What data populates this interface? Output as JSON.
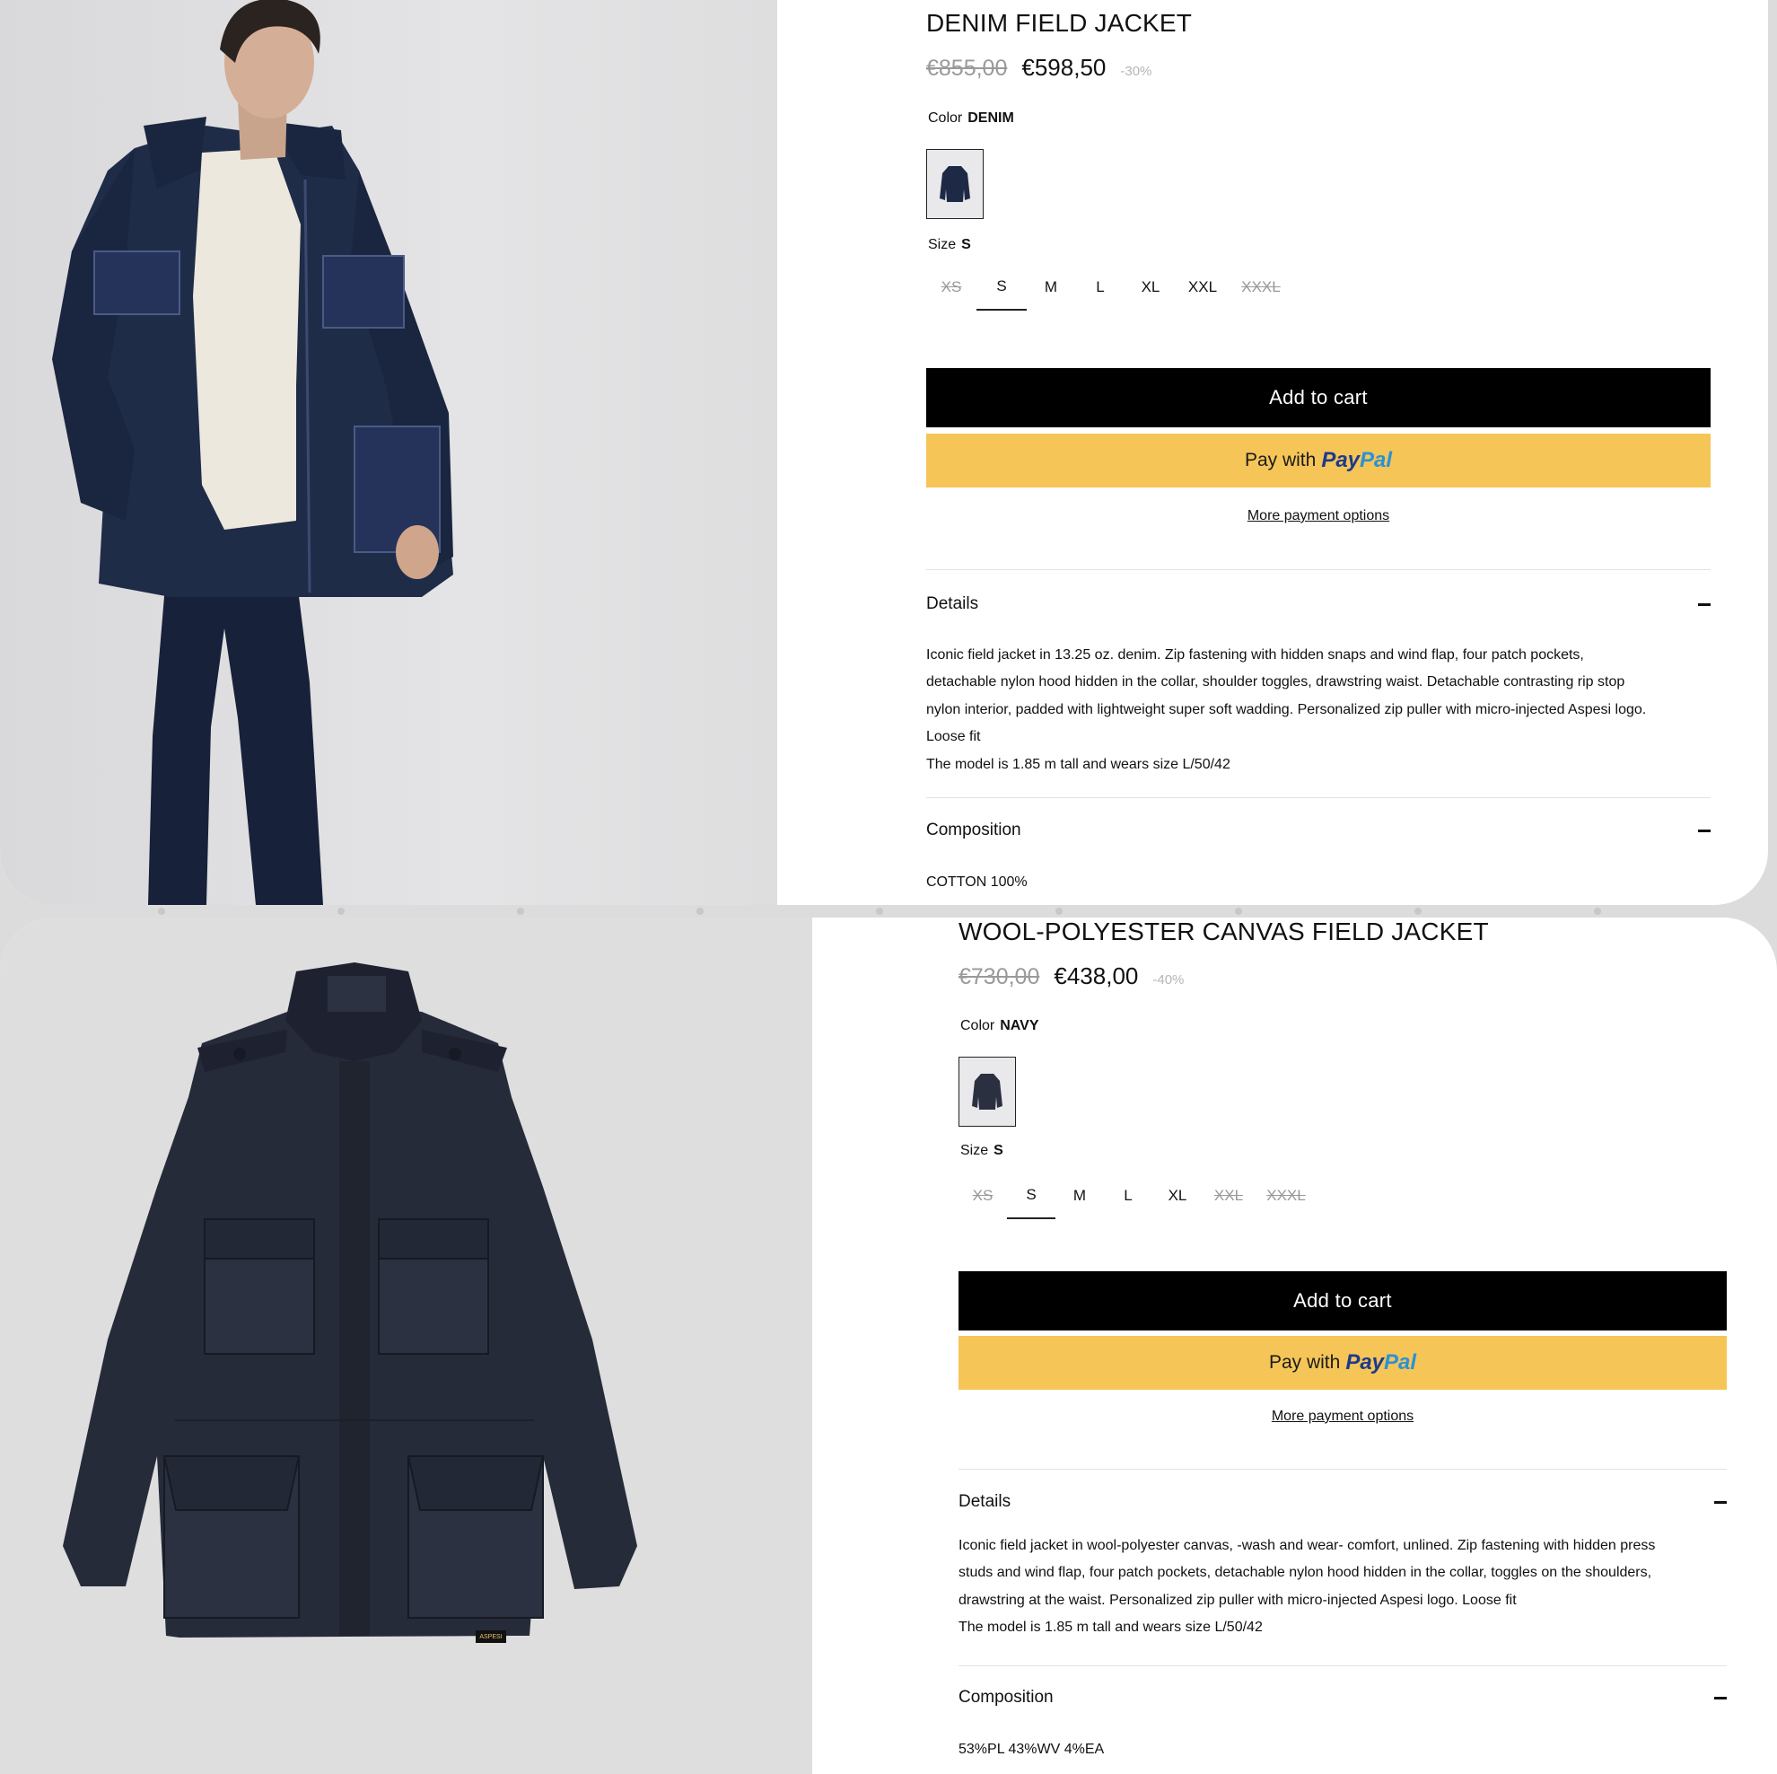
{
  "products": [
    {
      "title": "DENIM FIELD JACKET",
      "old_price": "€855,00",
      "price": "€598,50",
      "discount": "-30%",
      "color_label": "Color",
      "color_value": "DENIM",
      "size_label": "Size",
      "size_value": "S",
      "sizes": [
        {
          "label": "XS",
          "available": false
        },
        {
          "label": "S",
          "available": true,
          "selected": true
        },
        {
          "label": "M",
          "available": true
        },
        {
          "label": "L",
          "available": true
        },
        {
          "label": "XL",
          "available": true
        },
        {
          "label": "XXL",
          "available": true
        },
        {
          "label": "XXXL",
          "available": false
        }
      ],
      "add_to_cart": "Add to cart",
      "paypal_prefix": "Pay with",
      "paypal_brand_a": "Pay",
      "paypal_brand_b": "Pal",
      "more_payment": "More payment options",
      "details_title": "Details",
      "details_lines": [
        "Iconic field jacket in 13.25 oz. denim. Zip fastening with hidden snaps and wind flap, four patch pockets,",
        "detachable nylon hood hidden in the collar, shoulder toggles, drawstring waist. Detachable contrasting rip stop",
        "nylon interior, padded with lightweight super soft wadding. Personalized zip puller with micro-injected Aspesi logo.",
        "Loose fit",
        "The model is 1.85 m tall and wears size L/50/42"
      ],
      "composition_title": "Composition",
      "composition": "COTTON 100%"
    },
    {
      "title": "WOOL-POLYESTER CANVAS FIELD JACKET",
      "old_price": "€730,00",
      "price": "€438,00",
      "discount": "-40%",
      "color_label": "Color",
      "color_value": "NAVY",
      "size_label": "Size",
      "size_value": "S",
      "sizes": [
        {
          "label": "XS",
          "available": false
        },
        {
          "label": "S",
          "available": true,
          "selected": true
        },
        {
          "label": "M",
          "available": true
        },
        {
          "label": "L",
          "available": true
        },
        {
          "label": "XL",
          "available": true
        },
        {
          "label": "XXL",
          "available": false
        },
        {
          "label": "XXXL",
          "available": false
        }
      ],
      "add_to_cart": "Add to cart",
      "paypal_prefix": "Pay with",
      "paypal_brand_a": "Pay",
      "paypal_brand_b": "Pal",
      "more_payment": "More payment options",
      "details_title": "Details",
      "details_lines": [
        "Iconic field jacket in wool-polyester canvas, -wash and wear- comfort, unlined. Zip fastening with hidden press",
        "studs and wind flap, four patch pockets, detachable nylon hood hidden in the collar, toggles on the shoulders,",
        "drawstring at the waist. Personalized zip puller with micro-injected Aspesi logo. Loose fit",
        "The model is 1.85 m tall and wears size L/50/42"
      ],
      "composition_title": "Composition",
      "composition": "53%PL 43%WV 4%EA",
      "tag_text": "ASPESI"
    }
  ],
  "colors": {
    "paypal_yellow": "#f5c557",
    "paypal_dark_blue": "#1c3a8c",
    "paypal_light_blue": "#2b91d6",
    "cart_black": "#000000",
    "denim": "#1e2a45",
    "navy": "#2a3040"
  },
  "icons": [
    "minus-icon",
    "jacket-thumbnail"
  ]
}
